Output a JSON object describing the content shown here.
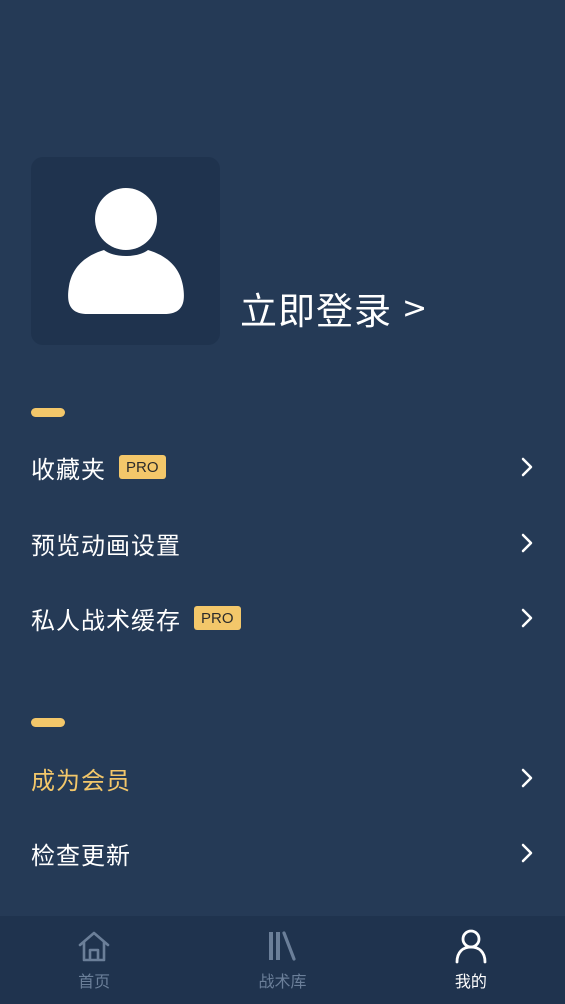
{
  "profile": {
    "login_text": "立即登录",
    "login_arrow": ">"
  },
  "menu": {
    "favorites": {
      "label": "收藏夹",
      "badge": "PRO"
    },
    "preview_animation": {
      "label": "预览动画设置"
    },
    "private_cache": {
      "label": "私人战术缓存",
      "badge": "PRO"
    },
    "membership": {
      "label": "成为会员"
    },
    "check_update": {
      "label": "检查更新"
    }
  },
  "tabbar": {
    "home": {
      "label": "首页",
      "icon": "home-icon"
    },
    "library": {
      "label": "战术库",
      "icon": "library-icon"
    },
    "mine": {
      "label": "我的",
      "icon": "user-icon",
      "active": true
    }
  },
  "colors": {
    "background": "#253a56",
    "panel": "#1f334e",
    "accent": "#f3c76a",
    "inactive": "#6b7f99"
  }
}
